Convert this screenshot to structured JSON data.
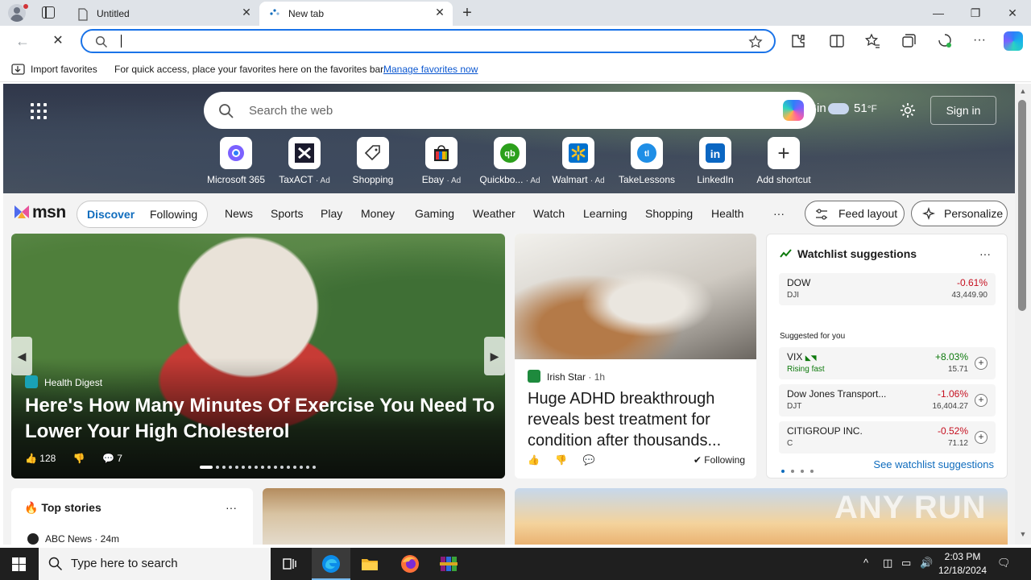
{
  "browser": {
    "tabs": [
      {
        "label": "Untitled",
        "active": false
      },
      {
        "label": "New tab",
        "active": true
      }
    ],
    "address_placeholder": "",
    "favorites_bar": {
      "import_label": "Import favorites",
      "message": "For quick access, place your favorites here on the favorites bar.",
      "manage_link": "Manage favorites now"
    }
  },
  "hero": {
    "search_placeholder": "Search the web",
    "weather_city": "Bin",
    "weather_temp": "51",
    "weather_unit": "°F",
    "sign_in": "Sign in",
    "shortcuts": [
      {
        "label": "Microsoft 365",
        "ad": ""
      },
      {
        "label": "TaxACT",
        "ad": "· Ad"
      },
      {
        "label": "Shopping",
        "ad": ""
      },
      {
        "label": "Ebay",
        "ad": "· Ad"
      },
      {
        "label": "Quickbo...",
        "ad": "· Ad"
      },
      {
        "label": "Walmart",
        "ad": "· Ad"
      },
      {
        "label": "TakeLessons",
        "ad": ""
      },
      {
        "label": "LinkedIn",
        "ad": ""
      },
      {
        "label": "Add shortcut",
        "ad": ""
      }
    ]
  },
  "nav": {
    "logo": "msn",
    "discover": "Discover",
    "following": "Following",
    "items": [
      "News",
      "Sports",
      "Play",
      "Money",
      "Gaming",
      "Weather",
      "Watch",
      "Learning",
      "Shopping",
      "Health"
    ],
    "more": "···",
    "feed_layout": "Feed layout",
    "personalize": "Personalize"
  },
  "big_card": {
    "source": "Health Digest",
    "title": "Here's How Many Minutes Of Exercise You Need To Lower Your High Cholesterol",
    "likes": "128",
    "comments": "7"
  },
  "mid_card": {
    "source": "Irish Star",
    "age": "· 1h",
    "title": "Huge ADHD breakthrough reveals best treatment for condition after thousands...",
    "following": "Following"
  },
  "watchlist": {
    "title": "Watchlist suggestions",
    "more": "···",
    "main": {
      "name": "DOW",
      "ticker": "DJI",
      "change": "-0.61%",
      "price": "43,449.90"
    },
    "suggested_label": "Suggested for you",
    "suggested": [
      {
        "name": "VIX",
        "sub": "Rising fast",
        "change": "+8.03%",
        "price": "15.71",
        "up": true
      },
      {
        "name": "Dow Jones Transport...",
        "sub": "DJT",
        "change": "-1.06%",
        "price": "16,404.27",
        "up": false
      },
      {
        "name": "CITIGROUP INC.",
        "sub": "C",
        "change": "-0.52%",
        "price": "71.12",
        "up": false
      }
    ],
    "see_more": "See watchlist suggestions"
  },
  "top_stories": {
    "title": "Top stories",
    "more": "···",
    "first_source": "ABC News · 24m"
  },
  "watermark": "ANY RUN",
  "taskbar": {
    "search_placeholder": "Type here to search",
    "time": "2:03 PM",
    "date": "12/18/2024"
  }
}
